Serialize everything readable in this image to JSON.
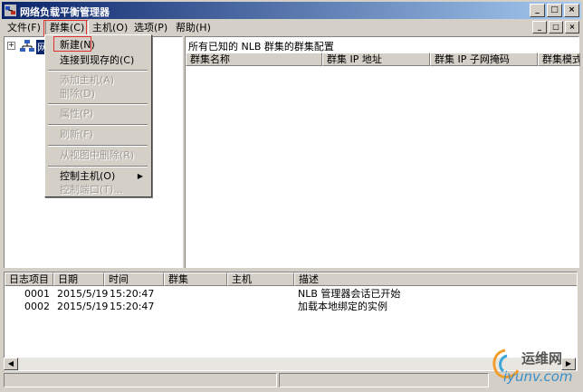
{
  "window": {
    "title": "网络负载平衡管理器",
    "buttons": {
      "minimize": "_",
      "maximize": "□",
      "close": "×"
    }
  },
  "menubar": {
    "items": [
      {
        "label": "文件(F)"
      },
      {
        "label": "群集(C)"
      },
      {
        "label": "主机(O)"
      },
      {
        "label": "选项(P)"
      },
      {
        "label": "帮助(H)"
      }
    ]
  },
  "cluster_menu": {
    "items": [
      {
        "label": "新建(N)",
        "enabled": true
      },
      {
        "label": "连接到现存的(C)",
        "enabled": true
      },
      {
        "label": "添加主机(A)",
        "enabled": false
      },
      {
        "label": "删除(D)",
        "enabled": false
      },
      {
        "label": "属性(P)",
        "enabled": false
      },
      {
        "label": "刷新(F)",
        "enabled": false
      },
      {
        "label": "从视图中删除(R)",
        "enabled": false
      },
      {
        "label": "控制主机(O)",
        "enabled": true,
        "submenu": "▶"
      },
      {
        "label": "控制端口(T)...",
        "enabled": false
      }
    ]
  },
  "tree": {
    "expander": "+",
    "root_label": "网"
  },
  "right_pane": {
    "header": "所有已知的 NLB 群集的群集配置",
    "columns": [
      "群集名称",
      "群集 IP 地址",
      "群集 IP 子网掩码",
      "群集模式"
    ]
  },
  "log": {
    "columns": [
      "日志项目",
      "日期",
      "时间",
      "群集",
      "主机",
      "描述"
    ],
    "rows": [
      [
        "0001",
        "2015/5/19",
        "15:20:47",
        "",
        "",
        "NLB 管理器会话已开始"
      ],
      [
        "0002",
        "2015/5/19",
        "15:20:47",
        "",
        "",
        "加载本地绑定的实例"
      ]
    ]
  },
  "scroll": {
    "left": "◀",
    "right": "▶"
  },
  "watermark": {
    "brand": "运维网",
    "url": "iyunv.com"
  },
  "colors": {
    "title_start": "#0a246a",
    "title_end": "#a6caf0",
    "highlight_box": "#e03030",
    "chrome": "#d4d0c8"
  }
}
